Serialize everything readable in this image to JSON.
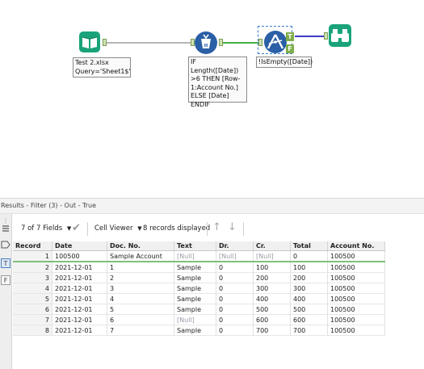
{
  "canvas": {
    "input_tool": {
      "annotation": "Test 2.xlsx\nQuery='Sheet1$'"
    },
    "formula_tool": {
      "annotation": "IF Length([Date])\n>6 THEN [Row-\n1:Account No.]\nELSE [Date]\nENDIF"
    },
    "filter_tool": {
      "annotation": "!IsEmpty([Date])",
      "true_label": "T",
      "false_label": "F"
    },
    "browse_tool": {}
  },
  "results": {
    "title": "Results - Filter (3) - Out - True",
    "toolbar": {
      "fields_label": "7 of 7 Fields",
      "viewer_label": "Cell Viewer",
      "records_label": "8 records displayed"
    },
    "side_tabs": {
      "true_tab": "T",
      "false_tab": "F"
    },
    "columns": [
      "Record",
      "Date",
      "Doc. No.",
      "Text",
      "Dr.",
      "Cr.",
      "Total",
      "Account No."
    ],
    "rows": [
      [
        "1",
        "100500",
        "Sample Account",
        "[Null]",
        "[Null]",
        "[Null]",
        "0",
        "100500"
      ],
      [
        "2",
        "2021-12-01",
        "1",
        "Sample",
        "0",
        "100",
        "100",
        "100500"
      ],
      [
        "3",
        "2021-12-01",
        "2",
        "Sample",
        "0",
        "200",
        "200",
        "100500"
      ],
      [
        "4",
        "2021-12-01",
        "3",
        "Sample",
        "0",
        "300",
        "300",
        "100500"
      ],
      [
        "5",
        "2021-12-01",
        "4",
        "Sample",
        "0",
        "400",
        "400",
        "100500"
      ],
      [
        "6",
        "2021-12-01",
        "5",
        "Sample",
        "0",
        "500",
        "500",
        "100500"
      ],
      [
        "7",
        "2021-12-01",
        "6",
        "[Null]",
        "0",
        "600",
        "600",
        "100500"
      ],
      [
        "8",
        "2021-12-01",
        "7",
        "Sample",
        "0",
        "700",
        "700",
        "100500"
      ]
    ]
  },
  "colors": {
    "input_tool": "#1aa37a",
    "formula_tool": "#2b5fa6",
    "filter_tool": "#2b5fa6",
    "browse_tool": "#1aa37a",
    "connection": "#3fae49",
    "true_connection": "#3c3cc8",
    "null_text": "#9a9aa8"
  }
}
